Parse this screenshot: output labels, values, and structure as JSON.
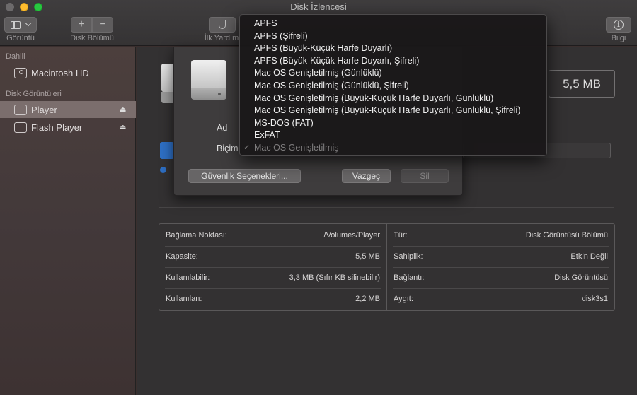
{
  "window": {
    "title": "Disk İzlencesi"
  },
  "toolbar": {
    "view_label": "Görüntü",
    "partition_label": "Disk Bölümü",
    "firstaid_label": "İlk Yardım",
    "info_label": "Bilgi",
    "add_glyph": "+",
    "remove_glyph": "−",
    "info_glyph": "i"
  },
  "sidebar": {
    "section_internal": "Dahili",
    "internal_items": [
      {
        "label": "Macintosh HD"
      }
    ],
    "section_images": "Disk Görüntüleri",
    "image_items": [
      {
        "label": "Player",
        "selected": true
      },
      {
        "label": "Flash Player"
      }
    ],
    "eject_glyph": "⏏"
  },
  "main": {
    "size_value": "5,5 MB"
  },
  "sheet": {
    "name_label_partial": "Ad",
    "format_label_partial": "Biçim",
    "security_button": "Güvenlik Seçenekleri...",
    "cancel_button": "Vazgeç",
    "erase_button": "Sil"
  },
  "format_menu": {
    "items": [
      "APFS",
      "APFS (Şifreli)",
      "APFS (Büyük-Küçük Harfe Duyarlı)",
      "APFS (Büyük-Küçük Harfe Duyarlı, Şifreli)",
      "Mac OS Genişletilmiş (Günlüklü)",
      "Mac OS Genişletilmiş (Günlüklü, Şifreli)",
      "Mac OS Genişletilmiş (Büyük-Küçük Harfe Duyarlı, Günlüklü)",
      "Mac OS Genişletilmiş (Büyük-Küçük Harfe Duyarlı, Günlüklü, Şifreli)",
      "MS-DOS (FAT)",
      "ExFAT"
    ],
    "selected_item": "Mac OS Genişletilmiş",
    "check_glyph": "✓"
  },
  "info": {
    "left": [
      {
        "label": "Bağlama Noktası:",
        "value": "/Volumes/Player"
      },
      {
        "label": "Kapasite:",
        "value": "5,5 MB"
      },
      {
        "label": "Kullanılabilir:",
        "value": "3,3 MB (Sıfır KB silinebilir)"
      },
      {
        "label": "Kullanılan:",
        "value": "2,2 MB"
      }
    ],
    "right": [
      {
        "label": "Tür:",
        "value": "Disk Görüntüsü Bölümü"
      },
      {
        "label": "Sahiplik:",
        "value": "Etkin Değil"
      },
      {
        "label": "Bağlantı:",
        "value": "Disk Görüntüsü"
      },
      {
        "label": "Aygıt:",
        "value": "disk3s1"
      }
    ]
  },
  "colors": {
    "accent": "#2e6fc4",
    "sidebar_selected": "#7b6e6d"
  }
}
